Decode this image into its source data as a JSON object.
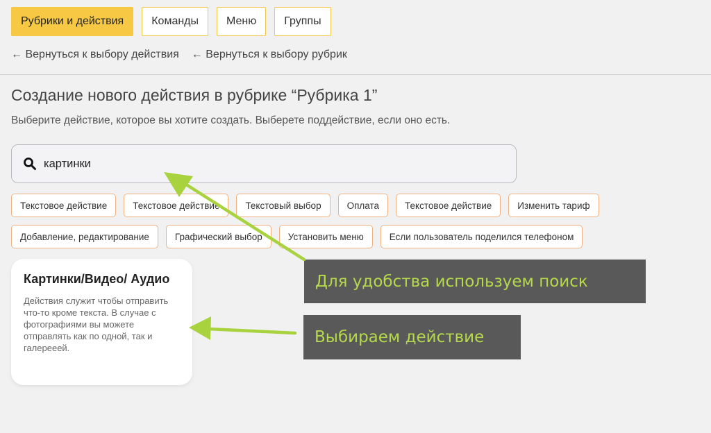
{
  "topnav": {
    "tabs": [
      {
        "label": "Рубрики и действия"
      },
      {
        "label": "Команды"
      },
      {
        "label": "Меню"
      },
      {
        "label": "Группы"
      }
    ]
  },
  "back_links": {
    "to_action": "← Вернуться к выбору действия",
    "to_rubrics": "← Вернуться к выбору рубрик"
  },
  "page": {
    "title": "Создание нового действия в рубрике “Рубрика 1”",
    "subtitle": "Выберите действие, которое вы хотите создать. Выберете поддействие, если оно есть."
  },
  "search": {
    "value": "картинки",
    "icon": "search-icon"
  },
  "chips": {
    "row1": [
      "Текстовое действие",
      "Текстовое действие",
      "Текстовый выбор",
      "Оплата",
      "Текстовое действие",
      "Изменить тариф"
    ],
    "row2": [
      "Добавление, редактирование",
      "Графический выбор",
      "Установить меню",
      "Если пользователь поделился телефоном"
    ]
  },
  "card": {
    "title": "Картинки/Видео/ Аудио",
    "description": "Действия служит чтобы отправить что-то кроме текста. В случае с фотографиями вы можете отправлять как по одной, так и галерееей."
  },
  "annotations": {
    "search_hint": "Для удобства используем поиск",
    "choose_action": "Выбираем действие"
  },
  "colors": {
    "accent_yellow": "#f6c844",
    "chip_border": "#f0b283",
    "annotation_bg": "#595959",
    "annotation_text": "#b5d94a",
    "arrow": "#a9d23f"
  }
}
